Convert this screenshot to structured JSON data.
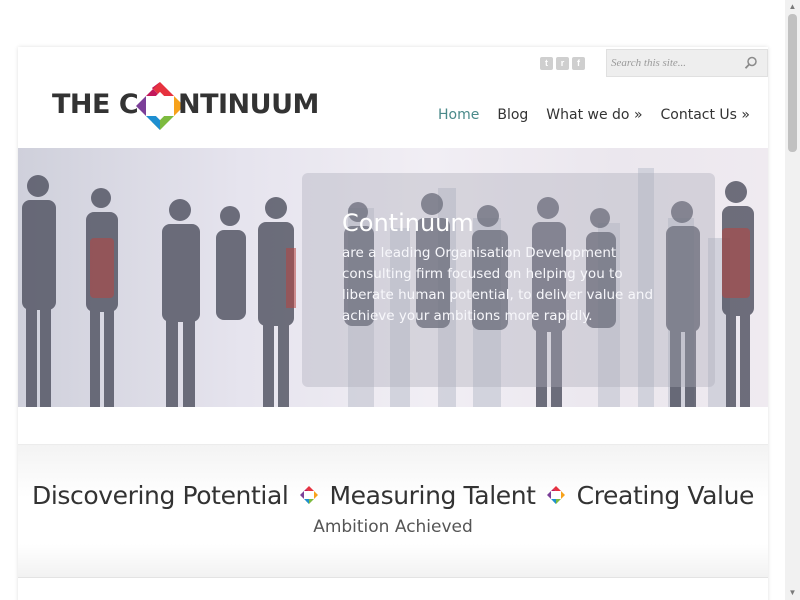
{
  "search": {
    "placeholder": "Search this site..."
  },
  "social": [
    {
      "name": "twitter-icon",
      "glyph": "t"
    },
    {
      "name": "rss-icon",
      "glyph": "r"
    },
    {
      "name": "facebook-icon",
      "glyph": "f"
    }
  ],
  "logo": {
    "part1": "THE C",
    "part2": "NTINUUM"
  },
  "nav": [
    {
      "label": "Home",
      "active": true
    },
    {
      "label": "Blog"
    },
    {
      "label": "What we do »"
    },
    {
      "label": "Contact Us »"
    }
  ],
  "hero": {
    "title": "Continuum",
    "text": "are a leading Organisation Development consulting firm focused on helping you to liberate human potential, to deliver value and achieve your ambitions more rapidly."
  },
  "tagline": {
    "part1": "Discovering Potential",
    "part2": "Measuring Talent",
    "part3": "Creating Value",
    "subtitle": "Ambition Achieved"
  },
  "colors": {
    "nav_active": "#4a8a8a",
    "diamond": [
      "#e6323f",
      "#f7a21b",
      "#7dbb3f",
      "#1e8fd1",
      "#7b3f98"
    ]
  }
}
